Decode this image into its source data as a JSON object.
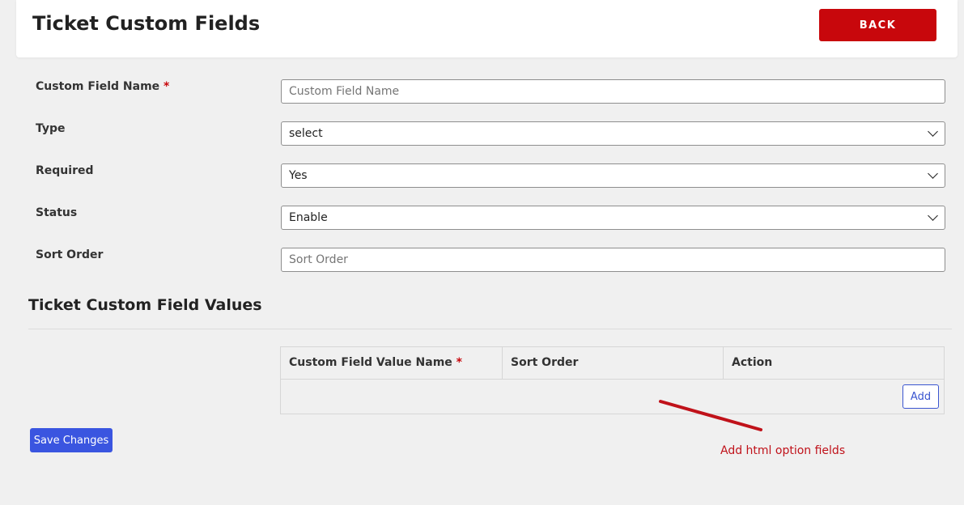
{
  "header": {
    "title": "Ticket Custom Fields",
    "back_label": "BACK"
  },
  "form": {
    "custom_field_name": {
      "label": "Custom Field Name",
      "required_mark": "*",
      "placeholder": "Custom Field Name",
      "value": ""
    },
    "type": {
      "label": "Type",
      "value": "select"
    },
    "required": {
      "label": "Required",
      "value": "Yes"
    },
    "status": {
      "label": "Status",
      "value": "Enable"
    },
    "sort_order": {
      "label": "Sort Order",
      "placeholder": "Sort Order",
      "value": ""
    }
  },
  "values_section": {
    "title": "Ticket Custom Field Values",
    "columns": [
      {
        "label": "Custom Field Value Name",
        "required_mark": "*"
      },
      {
        "label": "Sort Order"
      },
      {
        "label": "Action"
      }
    ],
    "add_label": "Add"
  },
  "save_label": "Save Changes",
  "annotation": {
    "text": "Add html option fields",
    "color": "#c0121a"
  },
  "colors": {
    "back_button": "#c8070c",
    "save_button": "#3a55e0",
    "background": "#f0f0f0"
  }
}
